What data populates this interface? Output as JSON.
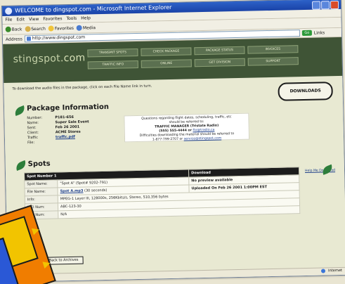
{
  "window": {
    "title": "WELCOME to dingspot.com - Microsoft Internet Explorer",
    "menu": [
      "File",
      "Edit",
      "View",
      "Favorites",
      "Tools",
      "Help"
    ],
    "toolbar": [
      "Back",
      "Search",
      "Favorites",
      "Media"
    ],
    "address_label": "Address",
    "address_value": "http://www.dingspot.com",
    "go_label": "Go",
    "links_label": "Links"
  },
  "site": {
    "logo_prefix": "stingspot",
    "logo_suffix": ".com",
    "nav": [
      "TRANSMIT SPOTS",
      "CHECK PACKAGE",
      "PACKAGE STATUS",
      "INVOICES",
      "TRAFFIC INFO",
      "ONLINE",
      "GET DIVISION",
      "SUPPORT"
    ],
    "intro": "To download the audio files in the package, click on each File Name link in turn.",
    "download_logo": "DOWNLOADS"
  },
  "package": {
    "title": "Package Information",
    "rows": [
      {
        "label": "Number:",
        "value": "P181-656",
        "link": false
      },
      {
        "label": "Name:",
        "value": "Super Sale Event",
        "link": false
      },
      {
        "label": "Sent:",
        "value": "Feb 26 2001",
        "link": false
      },
      {
        "label": "Client:",
        "value": "ACME Stores",
        "link": false
      },
      {
        "label": "Traffic File:",
        "value": "traffic.pdf",
        "link": true
      }
    ],
    "notice": {
      "line1": "Questions regarding flight dates, scheduling, traffic, etc",
      "line2": "should be referred to:",
      "line3": "TRAFFIC MANAGER (Tristate Radio)",
      "line4_prefix": "(555) 555-4444 or",
      "line4_link": "fto@tradio.ca",
      "line5": "Difficulties downloading the material should be referred to",
      "line6_prefix": "1-877-799-2707 or",
      "line6_link": "service@stingspot.com"
    }
  },
  "spots": {
    "title": "Spots",
    "header_left": "Spot Number 1",
    "header_right": "Download",
    "rows": [
      {
        "key": "Spot Name:",
        "value": "\"Spot A\" (Spot# 9202-791)",
        "right": "No preview available"
      },
      {
        "key": "File Name:",
        "value": "Spot A.mp3",
        "value_suffix": " (30 seconds)",
        "right": "Uploaded On Feb 26 2001 1:00PM EST"
      },
      {
        "key": "Info:",
        "value": "MPEG-1 Layer III, 128000s, 256Kbits/s, Stereo, 510,356 bytes",
        "right": ""
      },
      {
        "key": "ISCI Num:",
        "value": "ABC-123-30",
        "right": ""
      },
      {
        "key": "Rep Num:",
        "value": "N/A",
        "right": ""
      }
    ],
    "help_link": "Help Me Download"
  },
  "footer": {
    "back_button": "Back to Archives",
    "status_zone": "Internet"
  }
}
